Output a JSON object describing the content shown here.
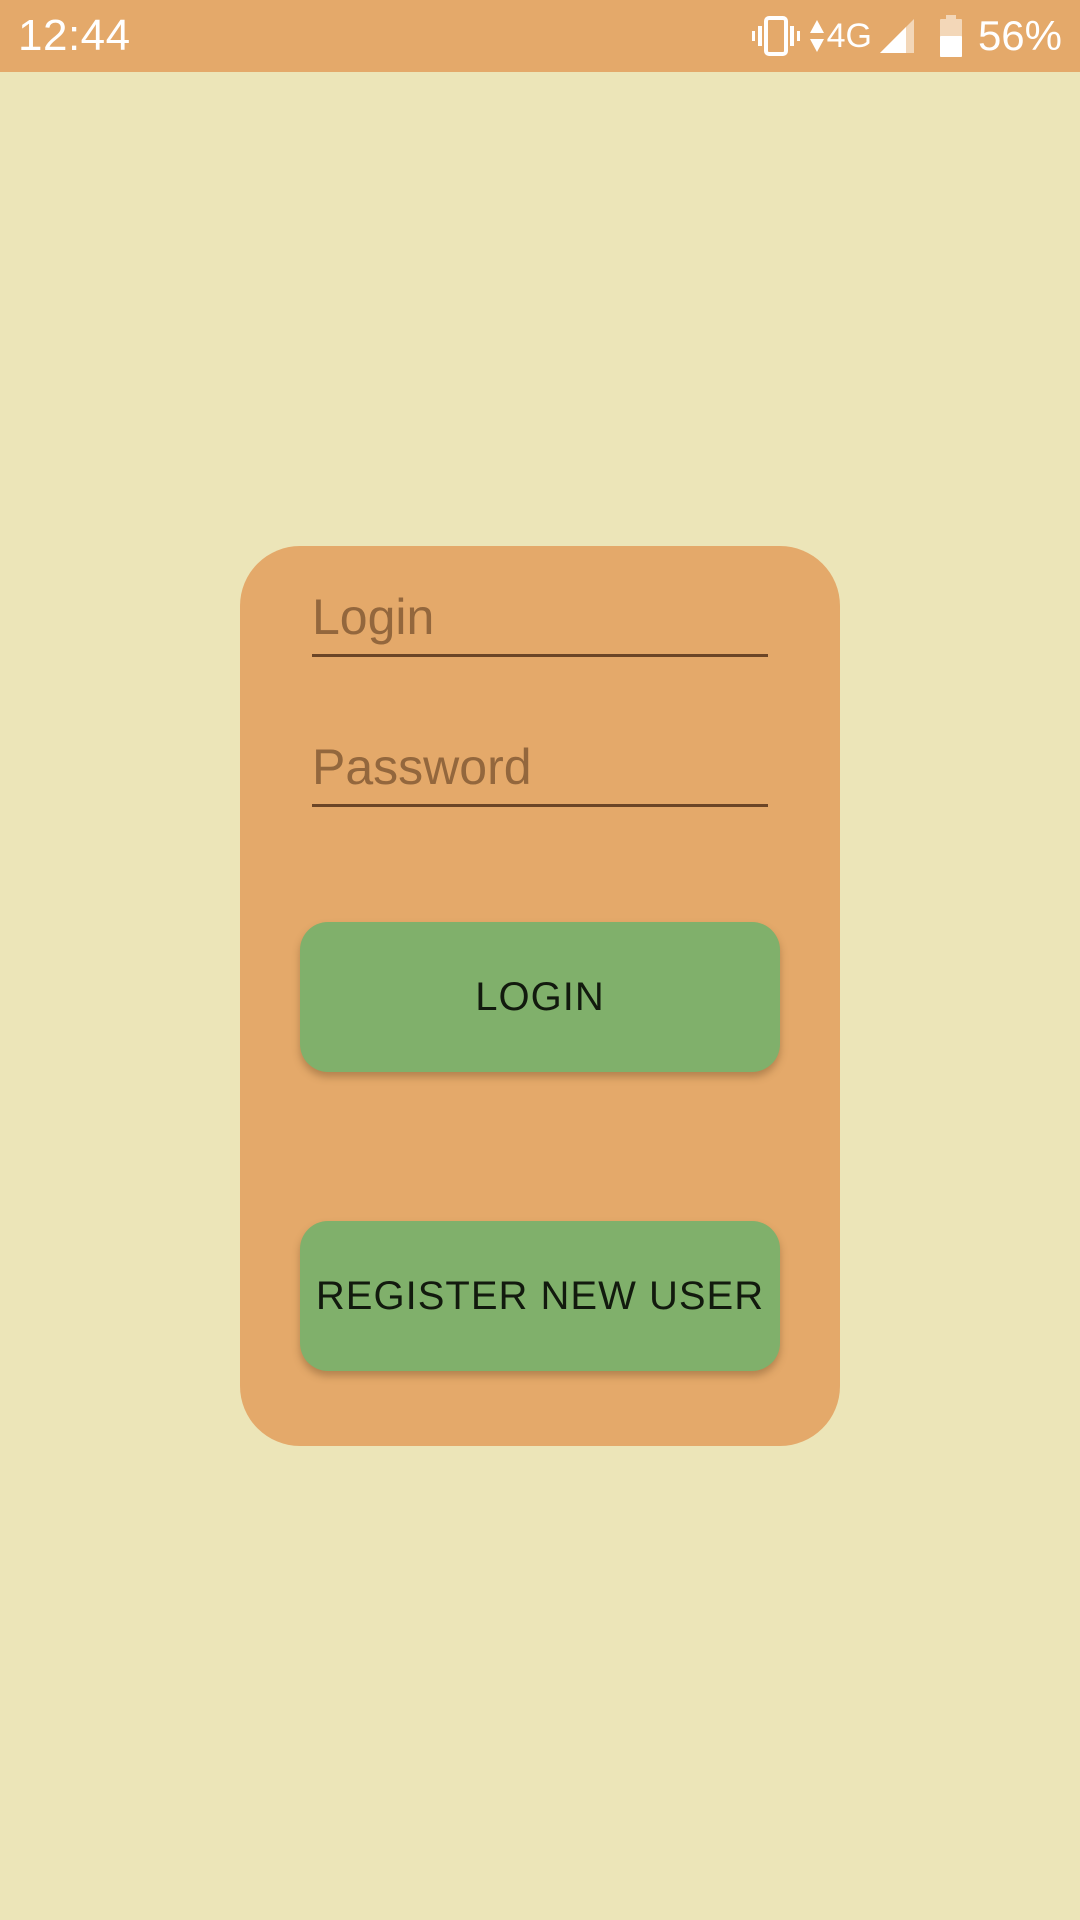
{
  "status_bar": {
    "time": "12:44",
    "network": "4G",
    "battery": "56%",
    "icons": [
      "vibrate-icon",
      "data-arrows-icon",
      "signal-icon",
      "battery-icon"
    ],
    "background": "#E4A96A"
  },
  "login_form": {
    "login_placeholder": "Login",
    "password_placeholder": "Password",
    "login_value": "",
    "password_value": "",
    "login_button": "LOGIN",
    "register_button": "REGISTER NEW USER"
  },
  "colors": {
    "background": "#ECE5B8",
    "card": "#E4A96A",
    "button": "#80B06B",
    "button_text": "#121A0E",
    "placeholder": "#93673D",
    "underline": "#6B4526"
  }
}
